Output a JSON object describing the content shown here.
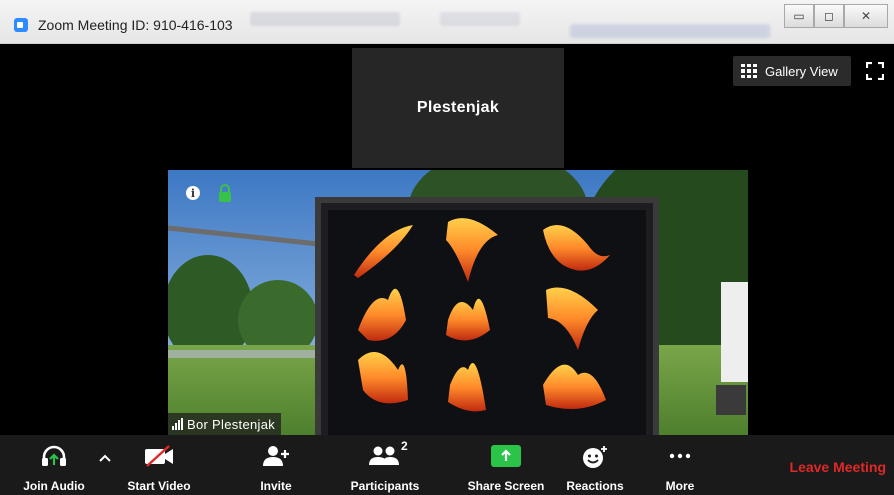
{
  "window": {
    "title": "Zoom Meeting ID: 910-416-103",
    "controls": {
      "minimize": "▭",
      "maximize": "◻",
      "close": "✕"
    }
  },
  "speaker_tile": {
    "name": "Plestenjak"
  },
  "view": {
    "gallery_label": "Gallery View"
  },
  "video": {
    "participant_name": "Bor Plestenjak",
    "info_glyph": "i"
  },
  "toolbar": {
    "join_audio": "Join Audio",
    "start_video": "Start Video",
    "invite": "Invite",
    "participants": "Participants",
    "participants_count": "2",
    "share_screen": "Share Screen",
    "reactions": "Reactions",
    "more": "More",
    "leave": "Leave Meeting"
  },
  "colors": {
    "share_green": "#2bc449",
    "leave_red": "#e02828",
    "toolbar_bg": "#1a1a1a"
  }
}
